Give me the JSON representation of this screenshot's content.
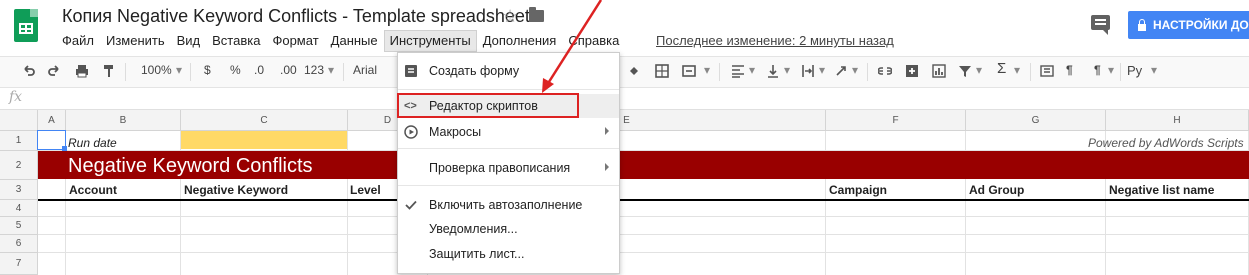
{
  "doc": {
    "title": "Копия Negative Keyword Conflicts - Template spreadsheet",
    "last_edit": "Последнее изменение: 2 минуты назад",
    "settings_label": "НАСТРОЙКИ ДО"
  },
  "menu": [
    "Файл",
    "Изменить",
    "Вид",
    "Вставка",
    "Формат",
    "Данные",
    "Инструменты",
    "Дополнения",
    "Справка"
  ],
  "toolbar": {
    "zoom": "100%",
    "currency": "$",
    "percent": "%",
    "dec_less": ".0",
    "dec_more": ".00",
    "format_more": "123",
    "font": "Arial",
    "input_tools": "Ру"
  },
  "formula_bar": {
    "fx": "fx"
  },
  "columns": [
    "A",
    "B",
    "C",
    "D",
    "E",
    "F",
    "G",
    "H"
  ],
  "rows": [
    "1",
    "2",
    "3",
    "4",
    "5",
    "6",
    "7"
  ],
  "sheet": {
    "run_date_label": "Run date",
    "powered_by": "Powered by AdWords Scripts",
    "title": "Negative Keyword Conflicts",
    "headers": {
      "account": "Account",
      "negative_keyword": "Negative Keyword",
      "level": "Level",
      "campaign": "Campaign",
      "ad_group": "Ad Group",
      "negative_list_name": "Negative list name"
    }
  },
  "dropdown": {
    "items": [
      {
        "label": "Создать форму",
        "icon": "form-icon"
      },
      {
        "label": "Редактор скриптов",
        "icon": "code-icon"
      },
      {
        "label": "Макросы",
        "icon": "play-icon",
        "submenu": true
      },
      {
        "label": "Проверка правописания",
        "submenu": true
      },
      {
        "label": "Включить автозаполнение",
        "icon": "check-icon"
      },
      {
        "label": "Уведомления..."
      },
      {
        "label": "Защитить лист..."
      }
    ]
  },
  "colors": {
    "title_bar": "#990000",
    "run_date_cell": "#ffd966",
    "annotation": "#dd2222",
    "accent": "#4285f4"
  }
}
